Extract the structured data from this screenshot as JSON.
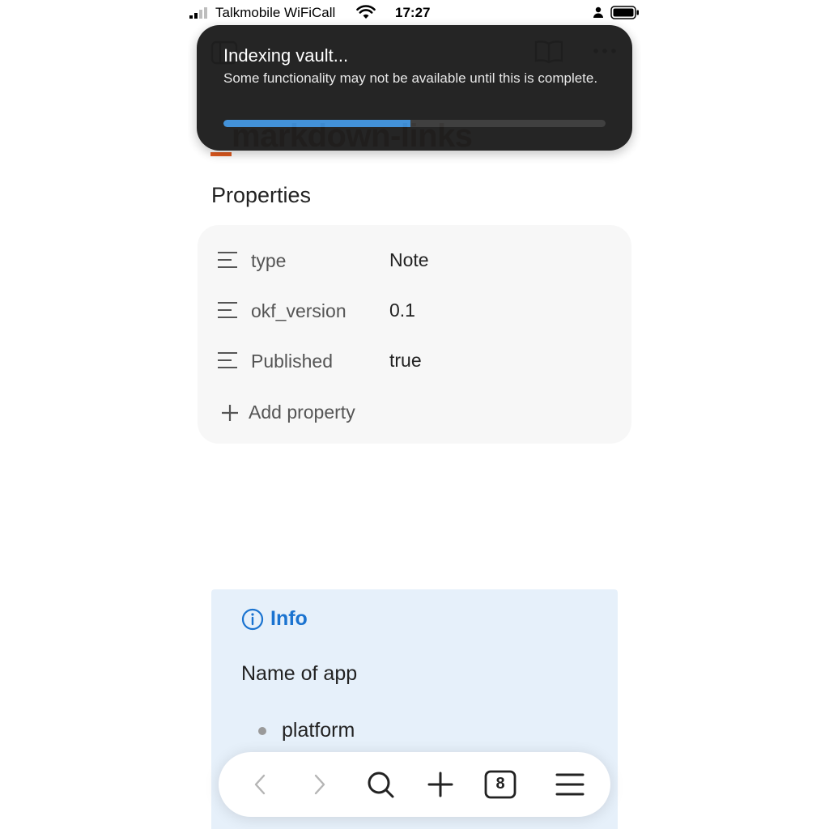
{
  "status_bar": {
    "carrier": "Talkmobile WiFiCall",
    "time": "17:27"
  },
  "header": {
    "sidebar_icon": "sidebar-toggle-icon",
    "reading_icon": "book-open-icon",
    "menu_icon": "more-horizontal-icon"
  },
  "page": {
    "title": "markdown-links"
  },
  "toast": {
    "title": "Indexing vault...",
    "message": "Some functionality may not be available until this is complete.",
    "progress_percent": 49
  },
  "properties": {
    "heading": "Properties",
    "rows": [
      {
        "key": "type",
        "value": "Note",
        "icon": "text-lines-icon"
      },
      {
        "key": "okf_version",
        "value": "0.1",
        "icon": "text-lines-icon"
      },
      {
        "key": "Published",
        "value": "true",
        "icon": "text-lines-icon"
      }
    ],
    "add_label": "Add property"
  },
  "callout": {
    "title": "Info",
    "text": "Name of app",
    "bullets": [
      "platform"
    ],
    "color": "#1a73d0"
  },
  "toolbar": {
    "tab_count": "8",
    "icons": [
      "back-icon",
      "forward-icon",
      "search-icon",
      "plus-icon",
      "tabs-icon",
      "hamburger-menu-icon"
    ]
  },
  "colors": {
    "accent": "#e05a1f",
    "progress": "#3d8fd8",
    "callout_bg": "#e6f0fa"
  }
}
